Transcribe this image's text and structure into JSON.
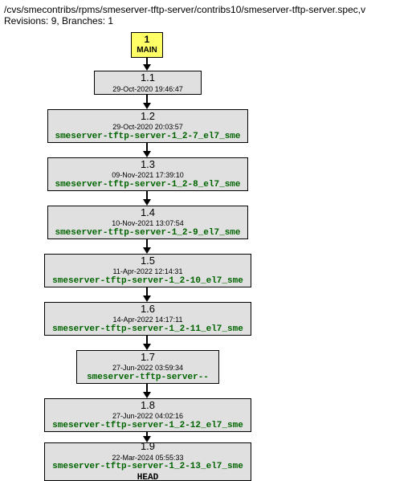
{
  "header": {
    "path": "/cvs/smecontribs/rpms/smeserver-tftp-server/contribs10/smeserver-tftp-server.spec,v",
    "revisions_label": "Revisions: 9, Branches: 1"
  },
  "main_node": {
    "number": "1",
    "label": "MAIN"
  },
  "nodes": [
    {
      "rev": "1.1",
      "date": "29-Oct-2020 19:46:47",
      "tag": "",
      "head": ""
    },
    {
      "rev": "1.2",
      "date": "29-Oct-2020 20:03:57",
      "tag": "smeserver-tftp-server-1_2-7_el7_sme",
      "head": ""
    },
    {
      "rev": "1.3",
      "date": "09-Nov-2021 17:39:10",
      "tag": "smeserver-tftp-server-1_2-8_el7_sme",
      "head": ""
    },
    {
      "rev": "1.4",
      "date": "10-Nov-2021 13:07:54",
      "tag": "smeserver-tftp-server-1_2-9_el7_sme",
      "head": ""
    },
    {
      "rev": "1.5",
      "date": "11-Apr-2022 12:14:31",
      "tag": "smeserver-tftp-server-1_2-10_el7_sme",
      "head": ""
    },
    {
      "rev": "1.6",
      "date": "14-Apr-2022 14:17:11",
      "tag": "smeserver-tftp-server-1_2-11_el7_sme",
      "head": ""
    },
    {
      "rev": "1.7",
      "date": "27-Jun-2022 03:59:34",
      "tag": "smeserver-tftp-server--",
      "head": ""
    },
    {
      "rev": "1.8",
      "date": "27-Jun-2022 04:02:16",
      "tag": "smeserver-tftp-server-1_2-12_el7_sme",
      "head": ""
    },
    {
      "rev": "1.9",
      "date": "22-Mar-2024 05:55:33",
      "tag": "smeserver-tftp-server-1_2-13_el7_sme",
      "head": "HEAD"
    }
  ]
}
